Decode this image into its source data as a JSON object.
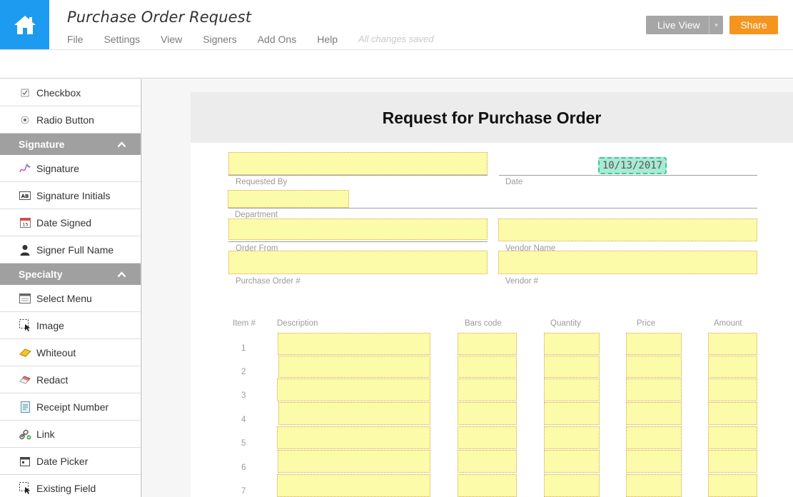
{
  "header": {
    "title": "Purchase Order Request",
    "menu": [
      "File",
      "Settings",
      "View",
      "Signers",
      "Add Ons",
      "Help"
    ],
    "status": "All changes saved",
    "live_view_label": "Live View",
    "share_label": "Share",
    "accent_color": "#1d9bf0",
    "share_color": "#f5951f"
  },
  "sidebar": {
    "top_items": [
      {
        "label": "Checkbox",
        "icon": "checkbox-icon"
      },
      {
        "label": "Radio Button",
        "icon": "radio-icon"
      }
    ],
    "sections": [
      {
        "title": "Signature",
        "items": [
          {
            "label": "Signature",
            "icon": "signature-pen-icon"
          },
          {
            "label": "Signature Initials",
            "icon": "initials-icon"
          },
          {
            "label": "Date Signed",
            "icon": "calendar-icon"
          },
          {
            "label": "Signer Full Name",
            "icon": "person-icon"
          }
        ]
      },
      {
        "title": "Specialty",
        "items": [
          {
            "label": "Select Menu",
            "icon": "select-menu-icon"
          },
          {
            "label": "Image",
            "icon": "image-select-icon"
          },
          {
            "label": "Whiteout",
            "icon": "eraser-icon"
          },
          {
            "label": "Redact",
            "icon": "redact-icon"
          },
          {
            "label": "Receipt Number",
            "icon": "receipt-icon"
          },
          {
            "label": "Link",
            "icon": "link-icon"
          },
          {
            "label": "Date Picker",
            "icon": "date-picker-icon"
          },
          {
            "label": "Existing Field",
            "icon": "existing-field-icon"
          }
        ]
      }
    ]
  },
  "document": {
    "title": "Request for Purchase Order",
    "date_value": "10/13/2017",
    "labels": {
      "requested_by": "Requested By",
      "date": "Date",
      "department": "Department",
      "order_from": "Order From",
      "vendor_name": "Vendor Name",
      "po_number": "Purchase Order #",
      "vendor_number": "Vendor #"
    },
    "table": {
      "columns": [
        "Item #",
        "Description",
        "Bars code",
        "Quantity",
        "Price",
        "Amount"
      ],
      "row_numbers": [
        "1",
        "2",
        "3",
        "4",
        "5",
        "6",
        "7"
      ]
    }
  }
}
